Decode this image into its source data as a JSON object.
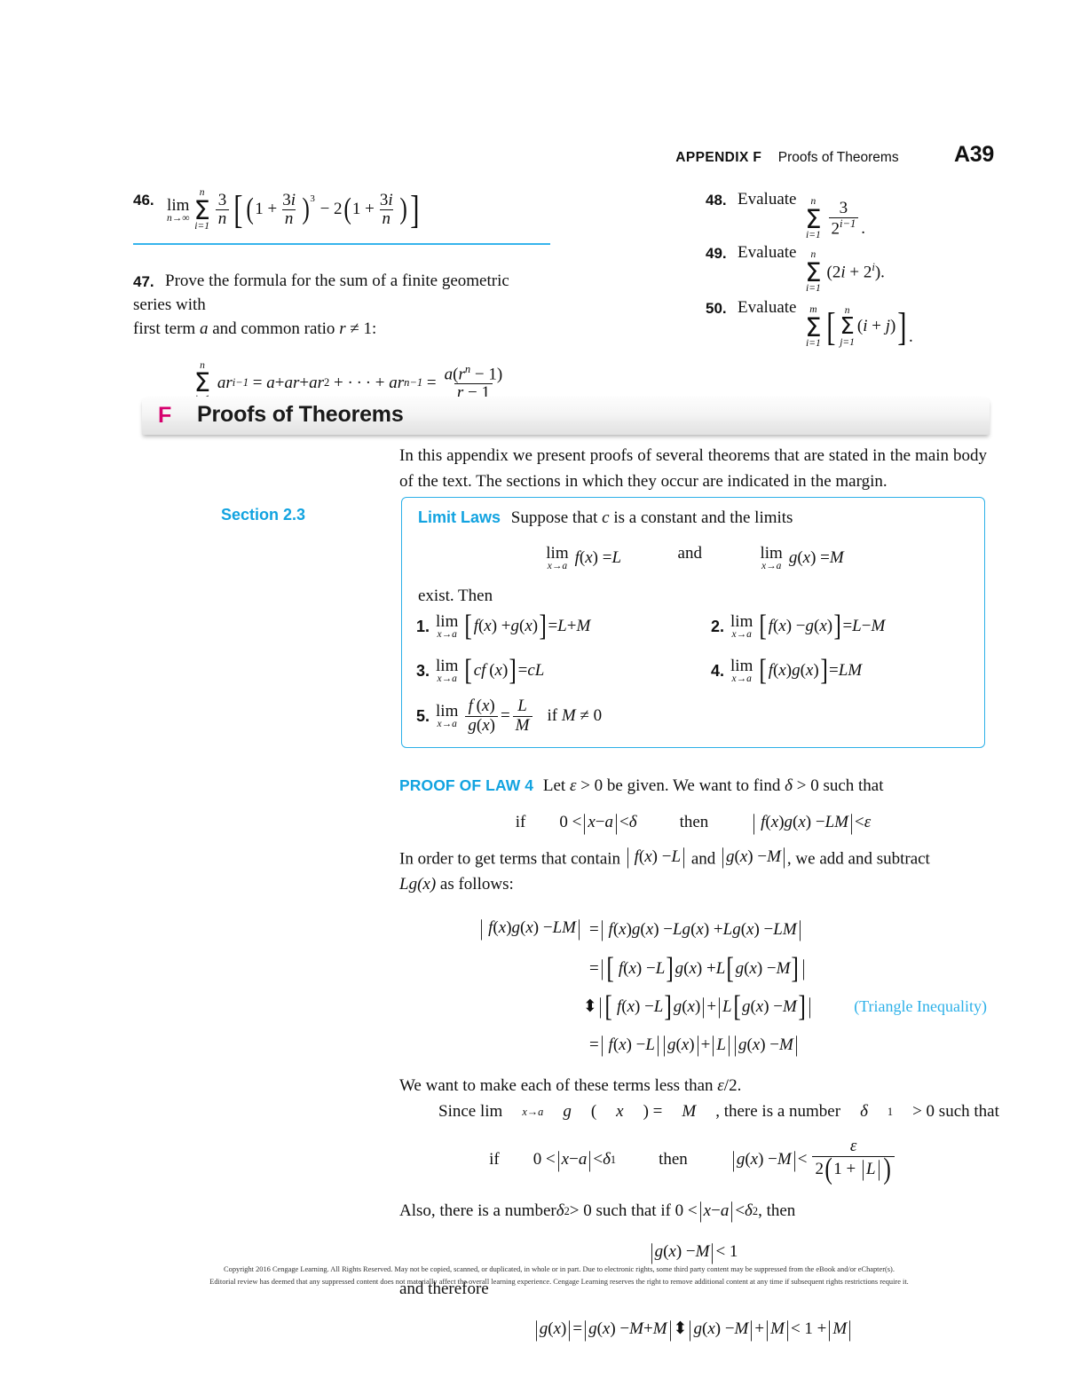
{
  "running_head": {
    "appendix_label": "APPENDIX F",
    "title": "Proofs of Theorems",
    "folio": "A39"
  },
  "exercises": {
    "left": [
      {
        "number": "46.",
        "type": "math",
        "plain": "lim (n→∞) Σ(i=1..n) (3/n)[ (1 + 3i/n)^3 − 2(1 + 3i/n) ]"
      },
      {
        "number": "47.",
        "type": "text+math",
        "text_line1": "Prove the formula for the sum of a finite geometric series with",
        "text_line2_pre": "first term",
        "text_line2_var1": "a",
        "text_line2_mid": "and common ratio",
        "text_line2_var2": "r",
        "text_line2_rel": "≠ 1:",
        "plain": "Σ(i=1..n) ar^(i−1) = a + ar + ar^2 + · · · + ar^(n−1) = a(r^n − 1)/(r − 1)"
      }
    ],
    "right": [
      {
        "number": "48.",
        "verb": "Evaluate",
        "plain": "Σ(i=1..n) 3/2^(i−1)."
      },
      {
        "number": "49.",
        "verb": "Evaluate",
        "plain": "Σ(i=1..n) (2i + 2^i)."
      },
      {
        "number": "50.",
        "verb": "Evaluate",
        "plain": "Σ(i=1..m) [ Σ(j=1..n) (i + j) ]."
      }
    ]
  },
  "section_header": {
    "letter": "F",
    "letter_color": "#D6006E",
    "title": "Proofs of Theorems"
  },
  "intro": "In this appendix we present proofs of several theorems that are stated in the main body of the text. The sections in which they occur are indicated in the margin.",
  "margin_note": "Section 2.3",
  "theorem_box": {
    "accent_color": "#2CB0E8",
    "label": "Limit Laws",
    "statement_pre": "Suppose that",
    "statement_var": "c",
    "statement_post": "is a constant and the limits",
    "hypothesis_conj": "and",
    "exist_text": "exist. Then",
    "laws": [
      {
        "number": "1.",
        "plain": "lim(x→a) [ f(x) + g(x) ] = L + M"
      },
      {
        "number": "2.",
        "plain": "lim(x→a) [ f(x) − g(x) ] = L − M"
      },
      {
        "number": "3.",
        "plain": "lim(x→a) [ cf(x) ] = cL"
      },
      {
        "number": "4.",
        "plain": "lim(x→a) [ f(x)g(x) ] = LM"
      },
      {
        "number": "5.",
        "plain": "lim(x→a) f(x)/g(x) = L/M   if M ≠ 0"
      }
    ]
  },
  "proof": {
    "label": "PROOF OF LAW 4",
    "label_color": "#12A3E0",
    "opening": "Let ε > 0 be given. We want to find δ > 0 such that",
    "display1": "if   0 < |x − a| < δ   then   | f(x)g(x) − LM | < ε",
    "para2_pre": "In order to get terms that contain",
    "para2_a": "| f(x) − L |",
    "para2_mid": "and",
    "para2_b": "| g(x) − M |",
    "para2_post": ", we add and subtract",
    "para2_lg": "Lg(x)",
    "para2_end": "as follows:",
    "chain": [
      {
        "lhs": "| f(x)g(x) − LM |",
        "rel": "=",
        "rhs": "| f(x)g(x) − Lg(x) + Lg(x) − LM |",
        "note": ""
      },
      {
        "lhs": "",
        "rel": "=",
        "rhs": "| [ f(x) − L ]g(x) + L[ g(x) − M ] |",
        "note": ""
      },
      {
        "lhs": "",
        "rel": "⩽",
        "rhs": "| [ f(x) − L ]g(x) | + | L[ g(x) − M ] |",
        "note": "(Triangle Inequality)"
      },
      {
        "lhs": "",
        "rel": "=",
        "rhs": "| f(x) − L || g(x) | + | L || g(x) − M |",
        "note": ""
      }
    ],
    "para3": "We want to make each of these terms less than ε/2.",
    "para4": "Since lim(x→a) g(x) = M, there is a number δ₁ > 0 such that",
    "display2": "if   0 < |x − a| < δ₁   then   | g(x) − M | < ε / (2(1 + |L|))",
    "para5": "Also, there is a number δ₂ > 0 such that if 0 < |x − a| < δ₂, then",
    "display3": "| g(x) − M | < 1",
    "para6": "and therefore",
    "display4": "| g(x) | = | g(x) − M + M | ⩽ | g(x) − M | + | M | < 1 + | M |"
  },
  "footer": {
    "line1": "Copyright 2016 Cengage Learning. All Rights Reserved. May not be copied, scanned, or duplicated, in whole or in part. Due to electronic rights, some third party content may be suppressed from the eBook and/or eChapter(s).",
    "line2": "Editorial review has deemed that any suppressed content does not materially affect the overall learning experience. Cengage Learning reserves the right to remove additional content at any time if subsequent rights restrictions require it."
  }
}
